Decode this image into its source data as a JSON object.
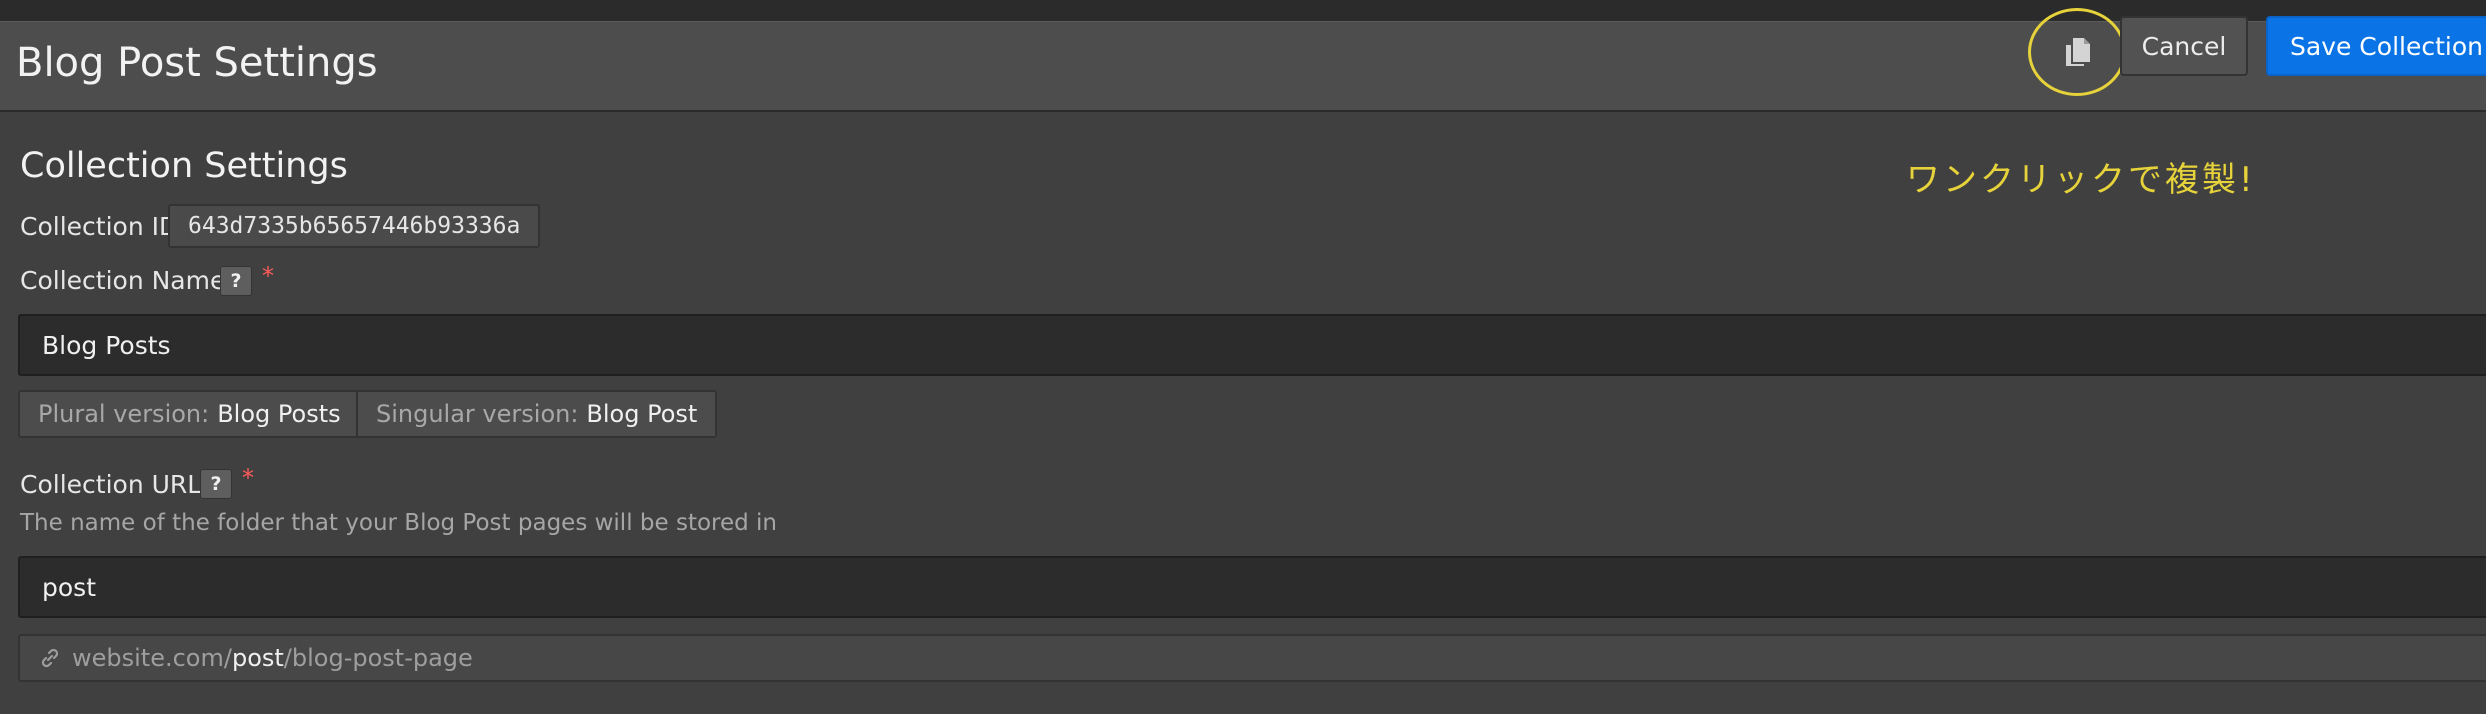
{
  "header": {
    "title": "Blog Post Settings",
    "cancel_label": "Cancel",
    "save_label": "Save Collection"
  },
  "annotation": "ワンクリックで複製!",
  "settings": {
    "section_title": "Collection Settings",
    "collection_id_label": "Collection ID",
    "collection_id_value": "643d7335b65657446b93336a",
    "collection_name_label": "Collection Name",
    "collection_name_value": "Blog Posts",
    "plural_key": "Plural version:",
    "plural_value": "Blog Posts",
    "singular_key": "Singular version:",
    "singular_value": "Blog Post",
    "collection_url_label": "Collection URL",
    "collection_url_hint": "The name of the folder that your Blog Post pages will be stored in",
    "collection_url_value": "post",
    "url_prefix": "website.com/",
    "url_slug": "post",
    "url_suffix": "/blog-post-page",
    "help_glyph": "?",
    "required_glyph": "*"
  },
  "colors": {
    "accent": "#0a73e6",
    "annotation": "#e6d23a",
    "required": "#ff5a5a"
  },
  "icons": {
    "duplicate": "copy-icon",
    "link": "link-icon",
    "help": "help-icon"
  }
}
